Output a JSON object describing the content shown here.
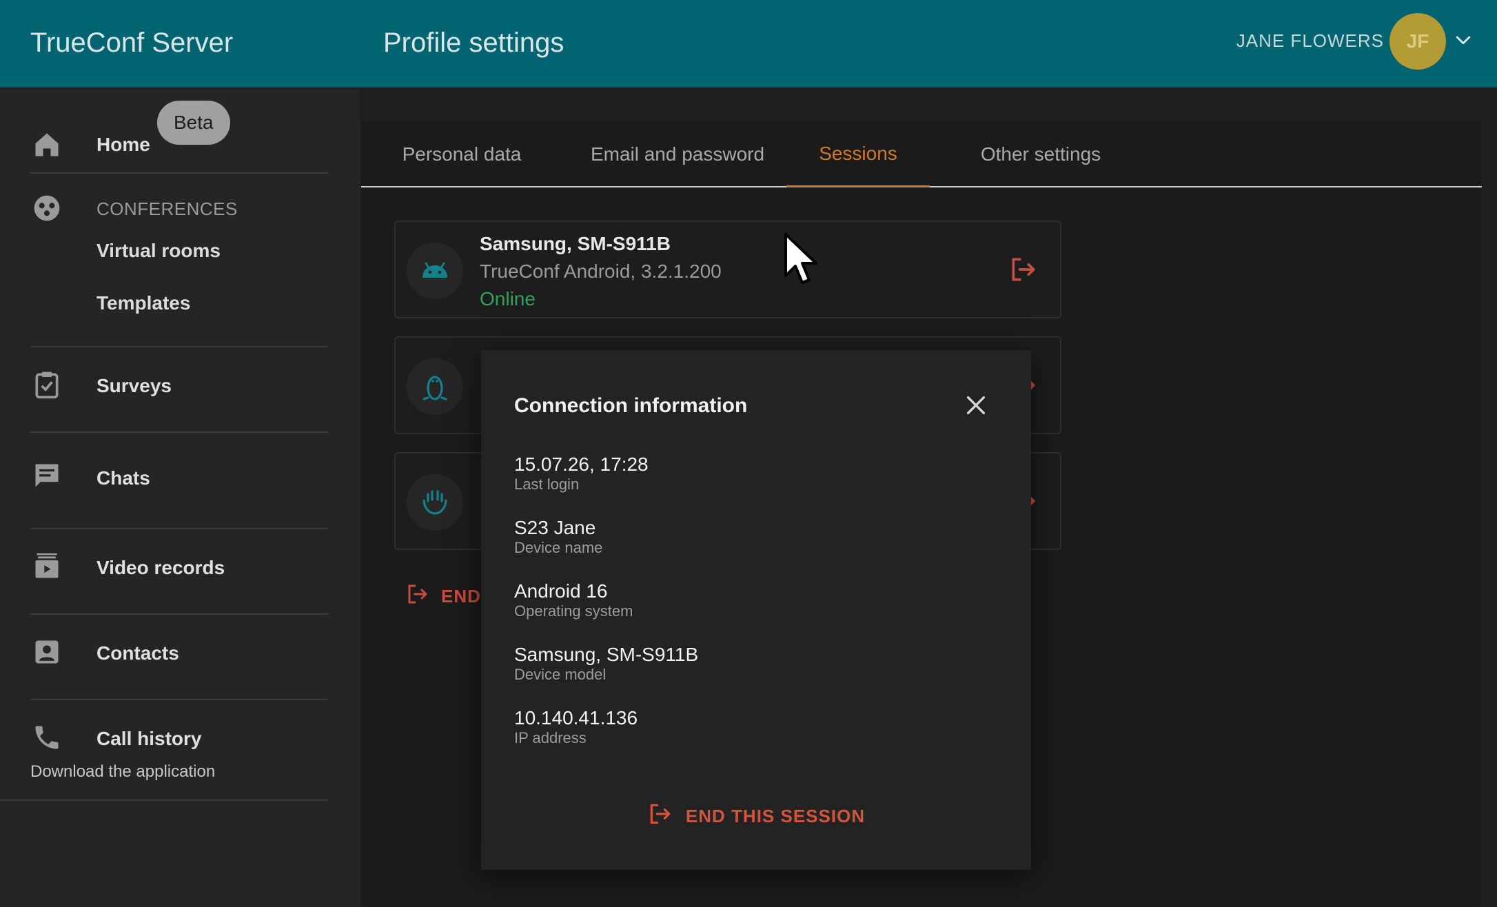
{
  "header": {
    "app_title": "TrueConf Server",
    "page_title": "Profile settings",
    "user_name": "JANE FLOWERS",
    "avatar_initials": "JF",
    "background_color": "#016470"
  },
  "sidebar": {
    "home": "Home",
    "conferences_section": "CONFERENCES",
    "virtual_rooms": "Virtual rooms",
    "templates": "Templates",
    "surveys": "Surveys",
    "chats": "Chats",
    "chats_badge": "Beta",
    "video_records": "Video records",
    "contacts": "Contacts",
    "call_history": "Call history",
    "download_app": "Download the application"
  },
  "tabs": [
    {
      "label": "Personal data",
      "active": false
    },
    {
      "label": "Email and password",
      "active": false
    },
    {
      "label": "Sessions",
      "active": true
    },
    {
      "label": "Other settings",
      "active": false
    }
  ],
  "sessions": [
    {
      "device": "Samsung, SM-S911B",
      "app": "TrueConf Android, 3.2.1.200",
      "status": "Online",
      "icon": "android-icon"
    },
    {
      "device": "",
      "app": "",
      "status": "",
      "icon": "linux-icon"
    },
    {
      "device": "",
      "app": "",
      "status": "",
      "icon": "conference-room-icon"
    }
  ],
  "end_all_label": "END",
  "dialog": {
    "title": "Connection information",
    "rows": [
      {
        "value": "15.07.26, 17:28",
        "label": "Last login"
      },
      {
        "value": "S23 Jane",
        "label": "Device name"
      },
      {
        "value": "Android 16",
        "label": "Operating system"
      },
      {
        "value": "Samsung, SM-S911B",
        "label": "Device model"
      },
      {
        "value": "10.140.41.136",
        "label": "IP address"
      }
    ],
    "end_session_label": "END THIS SESSION"
  },
  "colors": {
    "accent_tab": "#d2782a",
    "danger": "#d4553d",
    "online": "#2fa35d",
    "avatar": "#b39b36"
  }
}
